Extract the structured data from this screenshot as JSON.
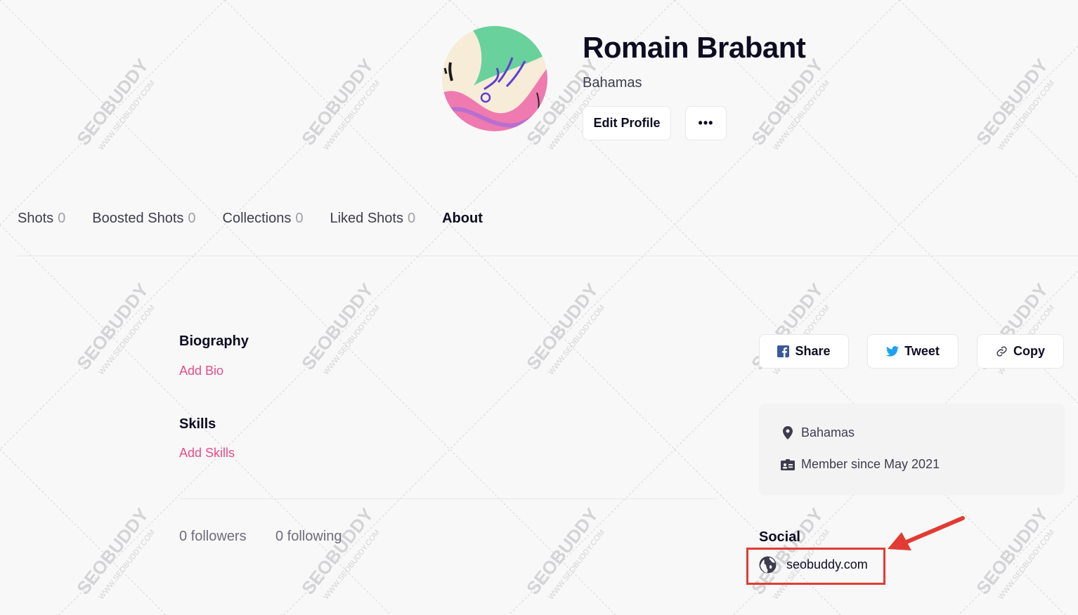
{
  "profile": {
    "name": "Romain Brabant",
    "location": "Bahamas",
    "edit_label": "Edit Profile",
    "more_label": "•••"
  },
  "tabs": [
    {
      "label": "Shots",
      "count": "0",
      "active": false
    },
    {
      "label": "Boosted Shots",
      "count": "0",
      "active": false
    },
    {
      "label": "Collections",
      "count": "0",
      "active": false
    },
    {
      "label": "Liked Shots",
      "count": "0",
      "active": false
    },
    {
      "label": "About",
      "count": "",
      "active": true
    }
  ],
  "about": {
    "biography_title": "Biography",
    "add_bio": "Add Bio",
    "skills_title": "Skills",
    "add_skills": "Add Skills",
    "followers": "0 followers",
    "following": "0 following"
  },
  "share": {
    "share_label": "Share",
    "tweet_label": "Tweet",
    "copy_label": "Copy"
  },
  "info": {
    "location": "Bahamas",
    "member_since": "Member since May 2021"
  },
  "social": {
    "title": "Social",
    "website": "seobuddy.com"
  },
  "watermark": {
    "brand": "SEOBUDDY",
    "url": "WWW.SEOBUDDY.COM"
  },
  "colors": {
    "accent_pink": "#ea4c89",
    "twitter_blue": "#1da1f2",
    "facebook_blue": "#3b5998",
    "annotation_red": "#e23b33"
  },
  "icons": {
    "facebook": "facebook-icon",
    "twitter": "twitter-icon",
    "copy": "link-icon",
    "location": "map-pin-icon",
    "member": "id-card-icon",
    "website": "globe-icon"
  }
}
